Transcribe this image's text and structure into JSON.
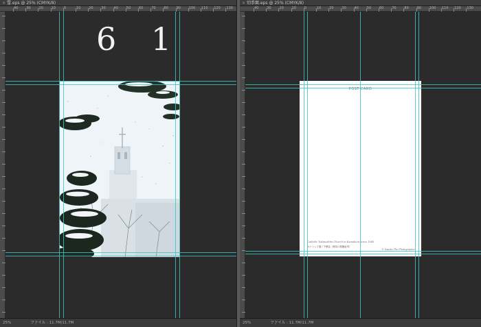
{
  "left_document": {
    "tab_title": "雪.eps @ 25% (CMYK/8)",
    "ruler_labels": [
      "40",
      "30",
      "20",
      "10",
      "0",
      "10",
      "20",
      "30",
      "40",
      "50",
      "60",
      "70",
      "80",
      "90",
      "100",
      "110",
      "120",
      "130",
      "14"
    ],
    "overlay_text": "6 1",
    "status_zoom": "25%",
    "status_file": "ファイル : 11.7M/11.7M"
  },
  "right_document": {
    "tab_title": "切手面.eps @ 25% (CMYK/8)",
    "ruler_labels": [
      "40",
      "30",
      "20",
      "10",
      "0",
      "10",
      "20",
      "30",
      "40",
      "50",
      "60",
      "70",
      "80",
      "90",
      "100",
      "110",
      "120",
      "130",
      "14"
    ],
    "card_title": "POST CARD",
    "caption_en": "Catholic Yukinoshita Church in Kamakura since 1949",
    "caption_jp": "カトリック雪ノ下教会（神奈川県鎌倉市）",
    "copyright": "© Yasuko The Photographer",
    "status_zoom": "25%",
    "status_file": "ファイル : 11.7M/11.7M"
  },
  "colors": {
    "guide": "#3fc6c0",
    "pasteboard": "#2b2b2b",
    "panel": "#4a4a4a"
  },
  "icons": {
    "tab_close": "close-icon"
  }
}
